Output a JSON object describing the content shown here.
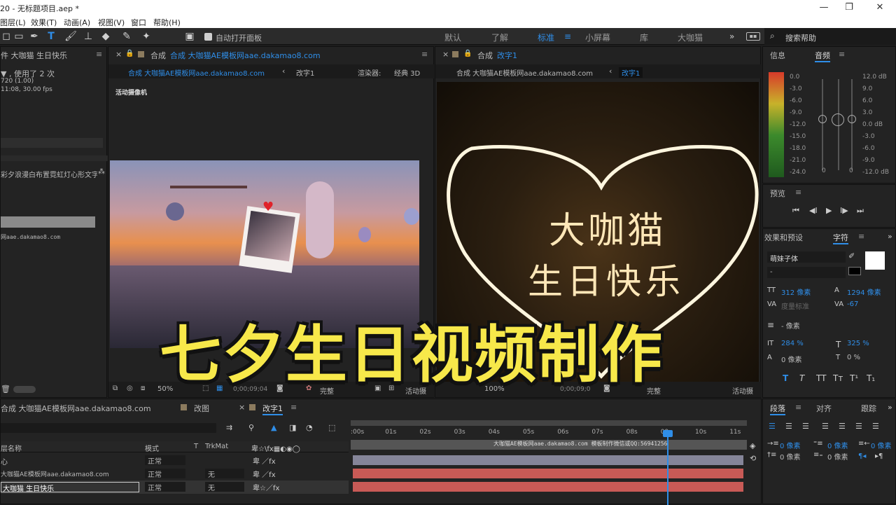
{
  "titlebar": {
    "title": "20 - 无标题项目.aep *"
  },
  "menu": [
    "图层(L)",
    "效果(T)",
    "动画(A)",
    "视图(V)",
    "窗口",
    "帮助(H)"
  ],
  "toolbar": {
    "auto_open": "自动打开面板"
  },
  "workspaces": [
    "默认",
    "了解",
    "标准",
    "小屏幕",
    "库",
    "大咖猫"
  ],
  "search": {
    "placeholder": "搜索帮助"
  },
  "project": {
    "tab": "件 大咖猫 生日快乐",
    "used": "▼ , 使用了 2 次",
    "res": "720 (1.00)",
    "dur": "11:08, 30.00 fps",
    "item": "彩夕浪漫白布置霓虹灯心形文字",
    "watermark": "网aae.dakamao8.com"
  },
  "comp1": {
    "tab_prefix": "合成",
    "tab_name": "合成 大咖猫AE模板网aae.dakamao8.com",
    "crumb1": "合成 大咖猫AE模板网aae.dakamao8.com",
    "crumb2": "改字1",
    "renderer_label": "渲染器:",
    "renderer": "经典 3D",
    "camera": "活动摄像机",
    "zoom": "50%",
    "time": "0;00;09;04",
    "quality": "完整",
    "cam": "活动摄"
  },
  "comp2": {
    "tab_prefix": "合成",
    "tab_name": "改字1",
    "crumb1": "合成 大咖猫AE模板网aae.dakamao8.com",
    "crumb2": "改字1",
    "zoom": "100%",
    "time": "0;00;09;0",
    "quality": "完整",
    "cam": "活动摄"
  },
  "neon": {
    "line1": "大咖猫",
    "line2": "生日快乐"
  },
  "overlay": "七夕生日视频制作",
  "info": {
    "tab1": "信息",
    "tab2": "音频",
    "db_left": [
      "0.0",
      "-3.0",
      "-6.0",
      "-9.0",
      "-12.0",
      "-15.0",
      "-18.0",
      "-21.0",
      "-24.0"
    ],
    "db_right": [
      "12.0 dB",
      "9.0",
      "6.0",
      "3.0",
      "0.0 dB",
      "-3.0",
      "-6.0",
      "-9.0",
      "-12.0 dB"
    ],
    "ch": [
      "0",
      "0"
    ]
  },
  "preview": {
    "title": "预览"
  },
  "char": {
    "tab1": "效果和预设",
    "tab2": "字符",
    "font": "萌妹子体",
    "style": "-",
    "size": "312 像素",
    "leading": "1294 像素",
    "kern": "度量标准",
    "track": "-67",
    "stroke": "- 像素",
    "vscale": "284 %",
    "hscale": "325 %",
    "baseline": "0 像素",
    "tsume": "0 %"
  },
  "para": {
    "tab1": "段落",
    "tab2": "对齐",
    "tab3": "跟踪",
    "v1": "0 像素",
    "v2": "0 像素",
    "v3": "0 像素",
    "v4": "0 像素",
    "v5": "0 像素"
  },
  "timeline": {
    "tab1": "合成 大咖猫AE模板网aae.dakamao8.com",
    "tab2": "改图",
    "tab3": "改字1",
    "cols": [
      "层名称",
      "模式",
      "T",
      "TrkMat"
    ],
    "ruler": [
      ":00s",
      "01s",
      "02s",
      "03s",
      "04s",
      "05s",
      "06s",
      "07s",
      "08s",
      "09s",
      "10s",
      "11s"
    ],
    "marker": "大咖猫AE模板网aae.dakamao8.com  模板制作微信或QQ:56941256",
    "layers": [
      {
        "name": "心",
        "mode": "正常",
        "trk": ""
      },
      {
        "name": "大咖猫AE模板网aae.dakamao8.com",
        "mode": "正常",
        "trk": "无"
      },
      {
        "name": "大咖猫 生日快乐",
        "mode": "正常",
        "trk": "无"
      }
    ]
  },
  "colors": {
    "accent": "#2f8ee8",
    "overlay_text": "#f7e84a",
    "bar_red": "#c85a56",
    "bar_gray": "#858599",
    "neon": "#ffd98a"
  }
}
